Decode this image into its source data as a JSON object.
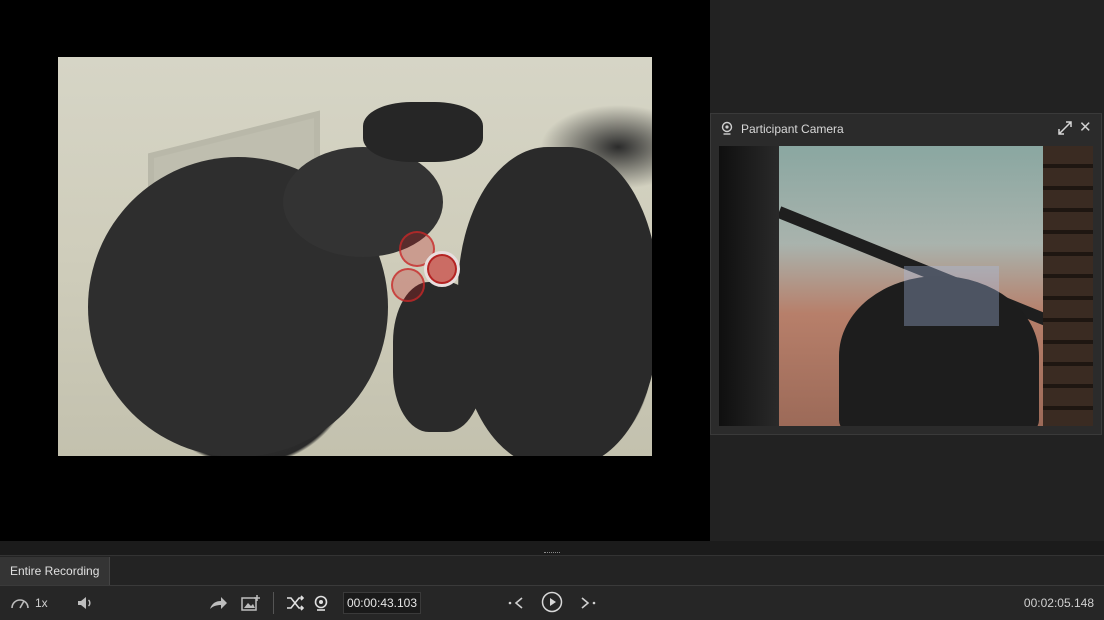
{
  "camera_window": {
    "title": "Participant Camera"
  },
  "tabs": [
    {
      "label": "Entire Recording"
    }
  ],
  "toolbar": {
    "speed_label": "1x",
    "current_time": "00:00:43.103",
    "total_duration": "00:02:05.148"
  },
  "icons": {
    "speed": "speedometer-icon",
    "volume": "volume-icon",
    "share": "share-icon",
    "snapshot": "image-add-icon",
    "shuffle": "shuffle-icon",
    "camera": "webcam-icon",
    "prev": "previous-event-icon",
    "play": "play-icon",
    "next": "next-event-icon",
    "expand": "expand-icon",
    "close": "close-icon"
  },
  "colors": {
    "gaze_marker": "#c42a2a",
    "background": "#1f1f1f"
  }
}
